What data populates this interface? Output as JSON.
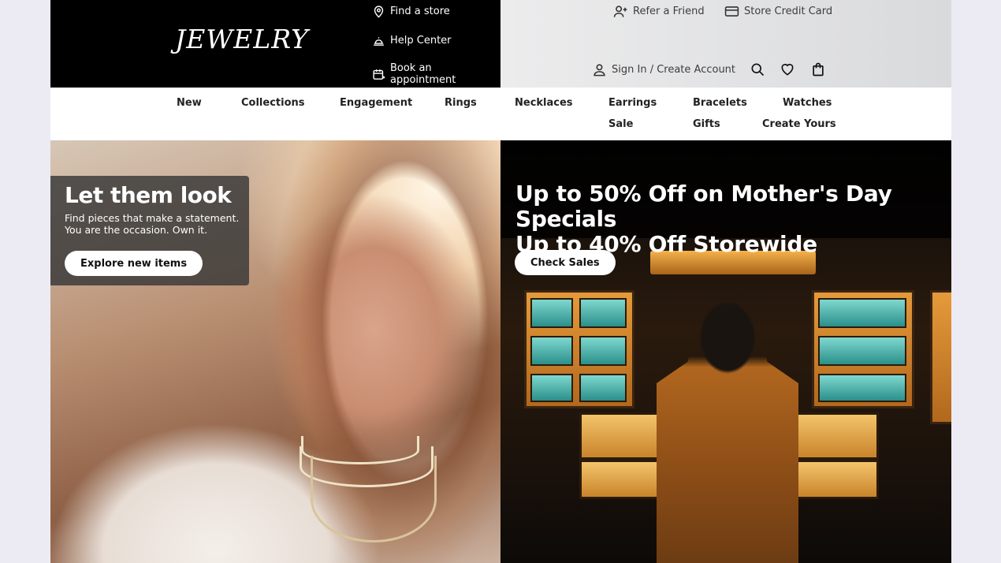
{
  "brand": {
    "logo_text": "JEWELRY"
  },
  "utility_links": {
    "find_store": "Find a store",
    "help_center": "Help Center",
    "book_appointment": "Book an appointment"
  },
  "account_links": {
    "refer_friend": "Refer a Friend",
    "store_credit": "Store Credit Card",
    "sign_in": "Sign In / Create Account"
  },
  "nav": {
    "row1": [
      "New",
      "Collections",
      "Engagement",
      "Rings",
      "Necklaces",
      "Earrings",
      "Bracelets",
      "Watches"
    ],
    "row2": [
      "Sale",
      "Gifts",
      "Create Yours"
    ]
  },
  "hero_left": {
    "title": "Let them look",
    "subtitle": "Find pieces that make a statement. You are the occasion. Own it.",
    "button": "Explore new items"
  },
  "hero_right": {
    "title_line1": "Up to 50% Off on Mother's Day Specials",
    "title_line2": "Up to 40% Off Storewide",
    "button": "Check Sales"
  },
  "icons": [
    "map-pin-icon",
    "bell-icon",
    "calendar-icon",
    "add-user-icon",
    "credit-card-icon",
    "user-icon",
    "search-icon",
    "heart-icon",
    "shopping-bag-icon"
  ],
  "colors": {
    "header_dark": "#000000",
    "header_light": "#e3e4e6",
    "text_dark": "#222222"
  }
}
